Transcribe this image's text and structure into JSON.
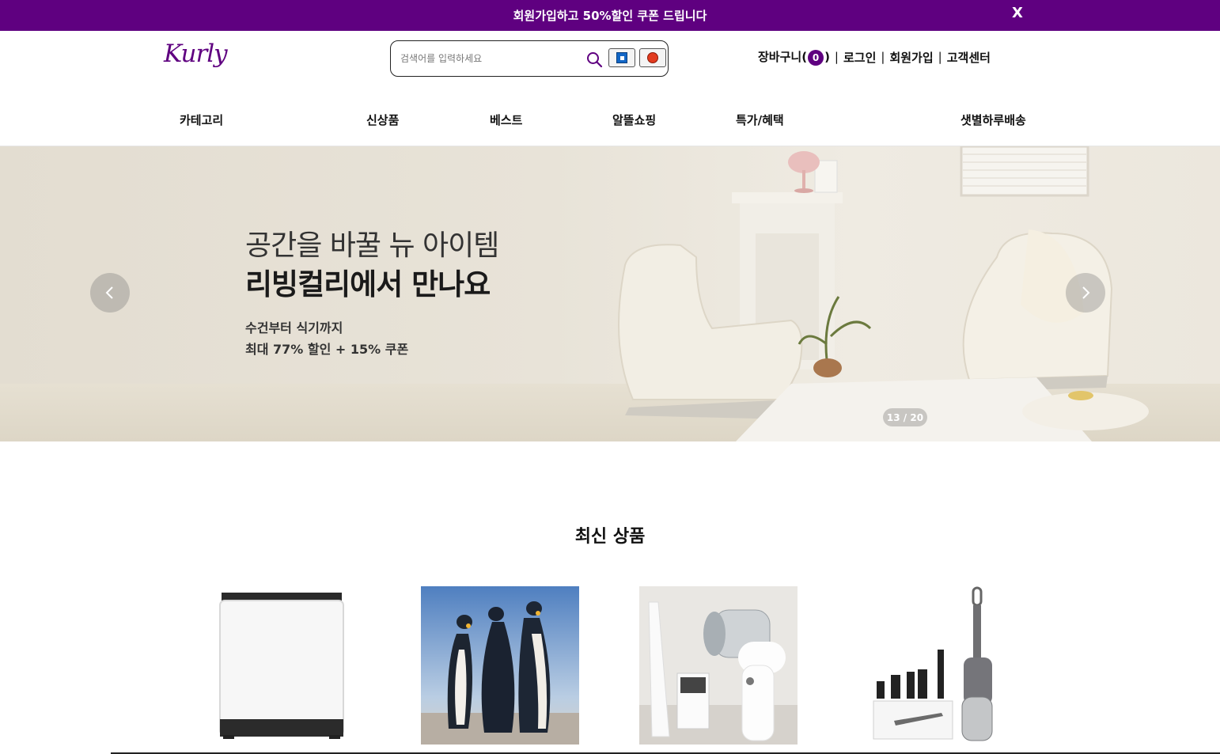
{
  "promo": {
    "text": "회원가입하고 50%할인 쿠폰 드립니다",
    "close_label": "X"
  },
  "header": {
    "logo": "Kurly",
    "search": {
      "placeholder": "검색어를 입력하세요",
      "value": ""
    },
    "user_menu": {
      "cart_label": "장바구니",
      "cart_count": "0",
      "login": "로그인",
      "signup": "회원가입",
      "customer_center": "고객센터",
      "separator": "|"
    }
  },
  "nav": {
    "items": [
      "카테고리",
      "신상품",
      "베스트",
      "알뜰쇼핑",
      "특가/혜택",
      "샛별하루배송"
    ]
  },
  "hero": {
    "line1": "공간을 바꿀 뉴 아이템",
    "line2": "리빙컬리에서 만나요",
    "line3": "수건부터 식기까지",
    "line4": "최대 77% 할인 + 15% 쿠폰",
    "page_indicator": "13 / 20",
    "current_slide": 13,
    "total_slides": 20
  },
  "section": {
    "title": "최신 상품"
  },
  "products": [
    {
      "icon": "washing-machine"
    },
    {
      "icon": "penguins"
    },
    {
      "icon": "handheld-vacuum"
    },
    {
      "icon": "stick-vacuum-set"
    }
  ],
  "colors": {
    "brand": "#5f0080",
    "promo_text": "#ffffff"
  }
}
